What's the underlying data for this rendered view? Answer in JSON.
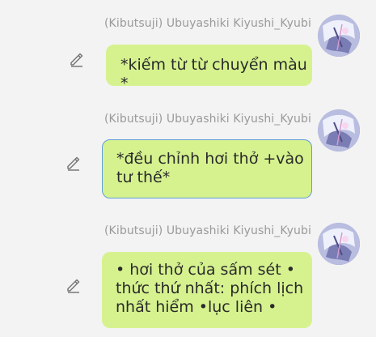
{
  "messages": [
    {
      "sender": "(Kibutsuji) Ubuyashiki Kiyushi_Kyubi",
      "lines": [
        "*kiếm từ từ chuyển màu *"
      ],
      "edit_icon": "pencil-icon",
      "bubble_color": "#d6f28f",
      "selected": false
    },
    {
      "sender": "(Kibutsuji) Ubuyashiki Kiyushi_Kyubi",
      "lines": [
        "*đều chỉnh hơi thở +vào",
        "tư thế*"
      ],
      "edit_icon": "pencil-icon",
      "bubble_color": "#d6f28f",
      "selected": true,
      "selection_color": "#5f9ed6"
    },
    {
      "sender": "(Kibutsuji) Ubuyashiki Kiyushi_Kyubi",
      "lines": [
        "• hơi thở của sấm sét •",
        "thức thứ nhất: phích lịch",
        "nhất hiểm •lục liên •"
      ],
      "edit_icon": "pencil-icon",
      "bubble_color": "#d6f28f",
      "selected": false
    }
  ],
  "colors": {
    "background": "#f3f3f3",
    "sender_text": "#9a9a9a",
    "message_text": "#2a2a2a"
  }
}
